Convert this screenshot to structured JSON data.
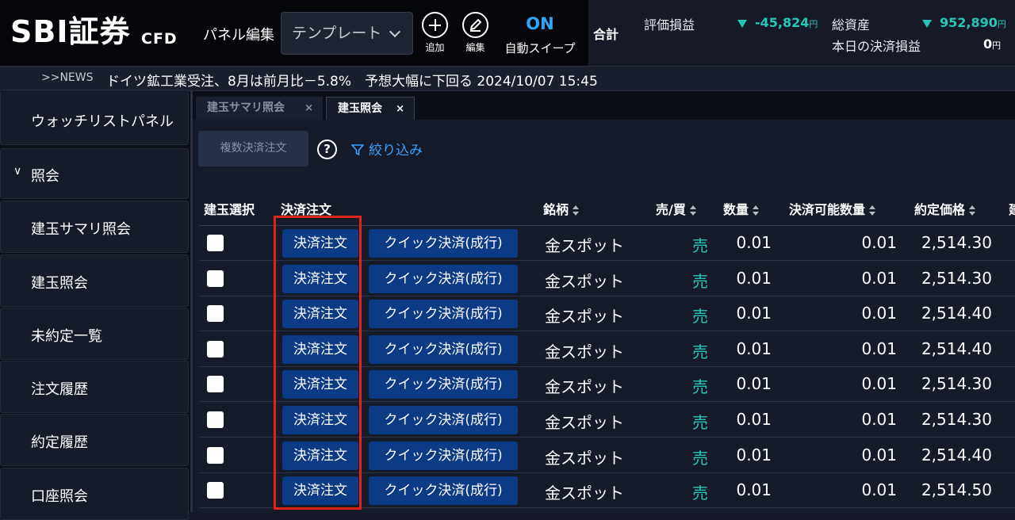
{
  "header": {
    "logo": "SBI証券",
    "logo_sub": "CFD",
    "panel_edit_label": "パネル編集",
    "template_select": "テンプレート",
    "add_label": "追加",
    "edit_label": "編集",
    "auto_sweep_state": "ON",
    "auto_sweep_label": "自動スイープ",
    "total_label": "合計",
    "valuation_label": "評価損益",
    "valuation_value": "-45,824",
    "total_assets_label": "総資産",
    "total_assets_value": "952,890",
    "today_settle_label": "本日の決済損益",
    "today_settle_value": "0",
    "yen": "円"
  },
  "news": {
    "tag": ">>NEWS",
    "text": "ドイツ鉱工業受注、8月は前月比－5.8%　予想大幅に下回る  2024/10/07 15:45"
  },
  "sidebar": {
    "top_item": "ウォッチリストパネル",
    "group": "照会",
    "items": [
      "建玉サマリ照会",
      "建玉照会",
      "未約定一覧",
      "注文履歴",
      "約定履歴",
      "口座照会"
    ]
  },
  "tabs": [
    {
      "label": "建玉サマリ照会",
      "close": "×"
    },
    {
      "label": "建玉照会",
      "close": "×"
    }
  ],
  "toolbar": {
    "multi_close_label": "複数決済注文",
    "help": "?",
    "filter_label": "絞り込み"
  },
  "table": {
    "headers": {
      "select": "建玉選択",
      "order": "決済注文",
      "symbol": "銘柄",
      "side": "売/買",
      "qty": "数量",
      "closable_qty": "決済可能数量",
      "price": "約定価格",
      "more": "建"
    },
    "close_btn": "決済注文",
    "quick_btn": "クイック決済(成行)",
    "rows": [
      {
        "symbol": "金スポット",
        "side": "売",
        "qty": "0.01",
        "closable": "0.01",
        "price": "2,514.30"
      },
      {
        "symbol": "金スポット",
        "side": "売",
        "qty": "0.01",
        "closable": "0.01",
        "price": "2,514.30"
      },
      {
        "symbol": "金スポット",
        "side": "売",
        "qty": "0.01",
        "closable": "0.01",
        "price": "2,514.40"
      },
      {
        "symbol": "金スポット",
        "side": "売",
        "qty": "0.01",
        "closable": "0.01",
        "price": "2,514.40"
      },
      {
        "symbol": "金スポット",
        "side": "売",
        "qty": "0.01",
        "closable": "0.01",
        "price": "2,514.30"
      },
      {
        "symbol": "金スポット",
        "side": "売",
        "qty": "0.01",
        "closable": "0.01",
        "price": "2,514.30"
      },
      {
        "symbol": "金スポット",
        "side": "売",
        "qty": "0.01",
        "closable": "0.01",
        "price": "2,514.40"
      },
      {
        "symbol": "金スポット",
        "side": "売",
        "qty": "0.01",
        "closable": "0.01",
        "price": "2,514.50"
      }
    ]
  },
  "colors": {
    "accent_blue": "#3aa2ff",
    "sell_teal": "#27c7b8",
    "button_blue": "#0c3b86",
    "highlight_red": "#e0231c"
  }
}
